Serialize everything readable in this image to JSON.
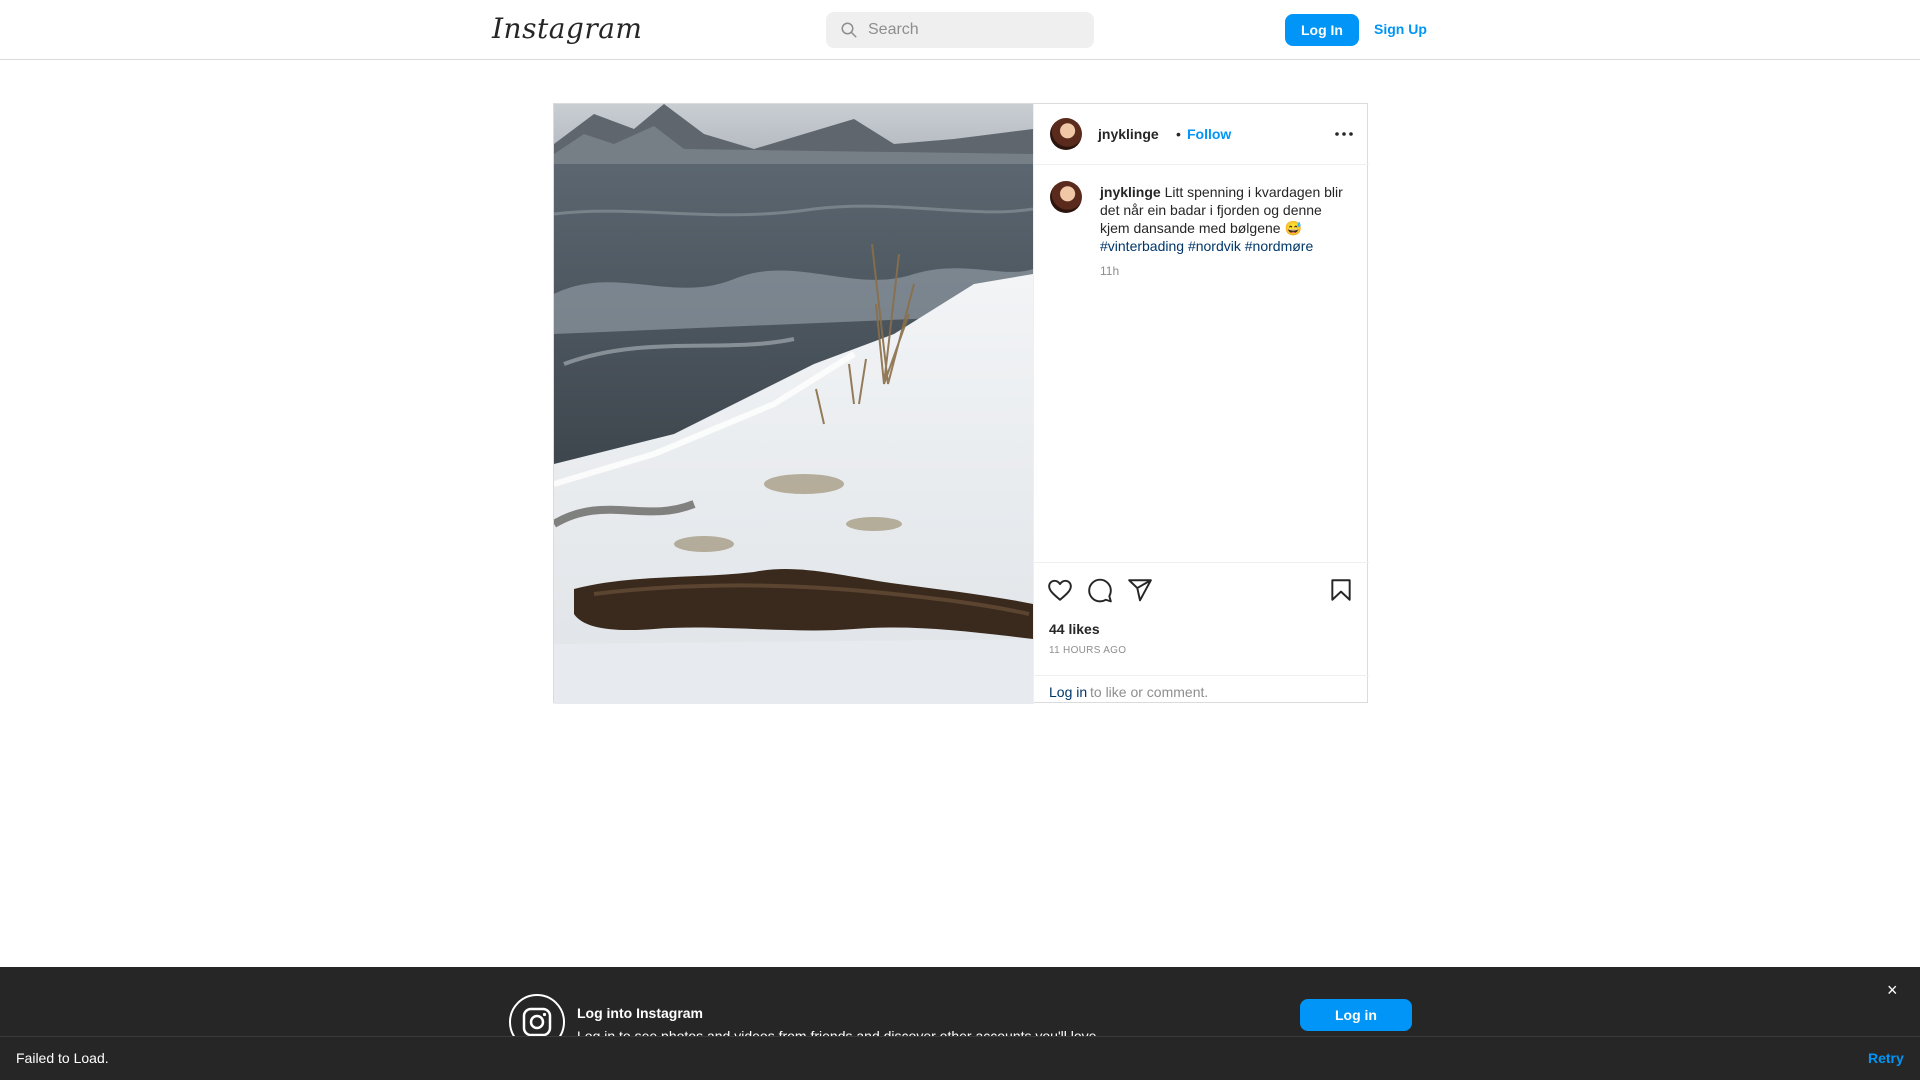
{
  "header": {
    "logo": "Instagram",
    "search_placeholder": "Search",
    "login_label": "Log In",
    "signup_label": "Sign Up"
  },
  "post": {
    "username": "jnyklinge",
    "separator": "•",
    "follow_label": "Follow",
    "caption": {
      "username": "jnyklinge",
      "text": "Litt spenning i kvardagen blir det når ein badar i fjorden og denne kjem dansande med bølgene 😅",
      "hashtags": [
        "#vinterbading",
        "#nordvik",
        "#nordmøre"
      ],
      "time": "11h"
    },
    "likes": "44 likes",
    "posted_ago": "11 HOURS AGO",
    "comment_prompt": {
      "link": "Log in",
      "text": "to like or comment."
    }
  },
  "login_banner": {
    "title": "Log into Instagram",
    "subtitle": "Log in to see photos and videos from friends and discover other accounts you'll love.",
    "button_label": "Log in",
    "close": "×"
  },
  "status_bar": {
    "message": "Failed to Load.",
    "retry_label": "Retry"
  },
  "colors": {
    "accent": "#0095f6",
    "link_dark": "#00376b",
    "banner_bg": "#262626"
  },
  "icons": [
    "search-icon",
    "more-options-icon",
    "heart-icon",
    "comment-icon",
    "share-icon",
    "bookmark-icon",
    "instagram-logo-icon",
    "close-icon"
  ]
}
